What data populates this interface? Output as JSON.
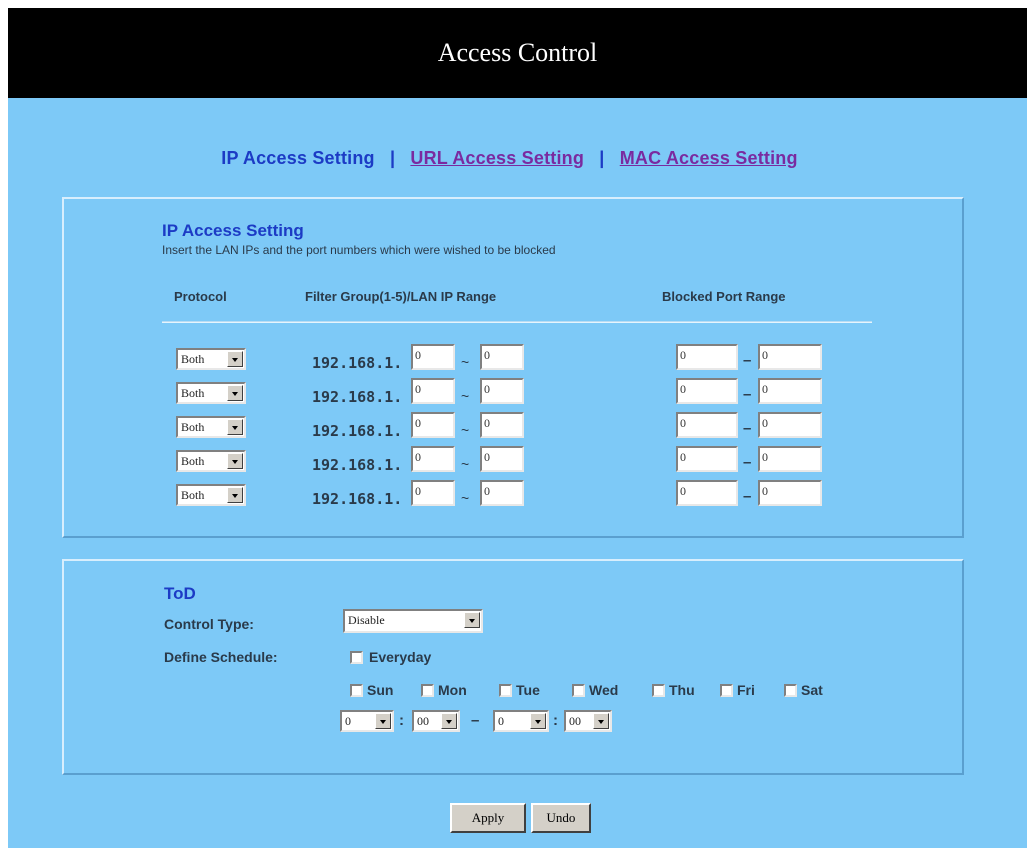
{
  "title": "Access Control",
  "nav": {
    "current": "IP Access Setting",
    "sep": "|",
    "url_link": "URL Access Setting",
    "mac_link": "MAC Access Setting"
  },
  "ip_section": {
    "title": "IP Access Setting",
    "description": "Insert the LAN IPs and the port numbers which were wished to be blocked",
    "col_protocol": "Protocol",
    "col_filter": "Filter Group(1-5)/LAN IP Range",
    "col_ports": "Blocked Port Range",
    "ip_prefix": "192.168.1.",
    "tilde": "~",
    "dash": "–",
    "rows": [
      {
        "protocol": "Both",
        "ip_start": "0",
        "ip_end": "0",
        "port_start": "0",
        "port_end": "0"
      },
      {
        "protocol": "Both",
        "ip_start": "0",
        "ip_end": "0",
        "port_start": "0",
        "port_end": "0"
      },
      {
        "protocol": "Both",
        "ip_start": "0",
        "ip_end": "0",
        "port_start": "0",
        "port_end": "0"
      },
      {
        "protocol": "Both",
        "ip_start": "0",
        "ip_end": "0",
        "port_start": "0",
        "port_end": "0"
      },
      {
        "protocol": "Both",
        "ip_start": "0",
        "ip_end": "0",
        "port_start": "0",
        "port_end": "0"
      }
    ]
  },
  "tod": {
    "title": "ToD",
    "control_type_label": "Control Type:",
    "control_type_value": "Disable",
    "schedule_label": "Define Schedule:",
    "everyday": "Everyday",
    "days": [
      "Sun",
      "Mon",
      "Tue",
      "Wed",
      "Thu",
      "Fri",
      "Sat"
    ],
    "start_hour": "0",
    "start_min": "00",
    "end_hour": "0",
    "end_min": "00",
    "colon": ":",
    "range_sep": "–"
  },
  "buttons": {
    "apply": "Apply",
    "undo": "Undo"
  },
  "colors": {
    "background": "#7dc9f7",
    "title_bar": "#000000",
    "heading": "#1c3bc5",
    "link": "#7a2aa0"
  }
}
